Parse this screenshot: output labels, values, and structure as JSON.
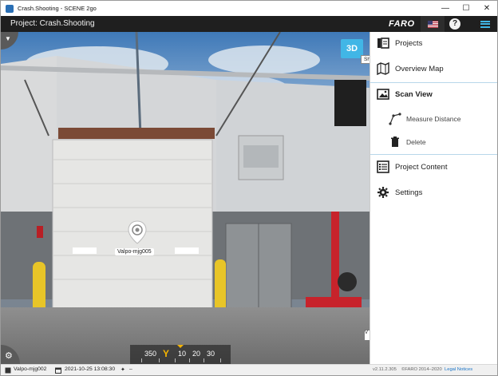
{
  "window": {
    "title": "Crash.Shooting - SCENE 2go",
    "controls": {
      "minimize": "—",
      "maximize": "☐",
      "close": "✕"
    }
  },
  "appbar": {
    "project_label": "Project: Crash.Shooting",
    "brand": "FARO",
    "help": "?"
  },
  "scene": {
    "view_mode_button": "3D",
    "tooltip": "Show Panorama Image",
    "scan_marker_label": "Valpo-mjg005",
    "compass": {
      "values": [
        "350",
        "10",
        "20",
        "30"
      ],
      "heading": "Y"
    },
    "edge_label": "V"
  },
  "menu": {
    "items": [
      {
        "label": "Projects",
        "icon": "projects-icon"
      },
      {
        "label": "Overview Map",
        "icon": "map-icon"
      },
      {
        "label": "Scan View",
        "icon": "image-icon",
        "active": true
      },
      {
        "label": "Measure Distance",
        "icon": "measure-icon",
        "sub": true
      },
      {
        "label": "Delete",
        "icon": "trash-icon",
        "sub": true
      },
      {
        "label": "Project Content",
        "icon": "list-icon"
      },
      {
        "label": "Settings",
        "icon": "gear-icon"
      }
    ]
  },
  "statusbar": {
    "scan_name": "Valpo-mjg002",
    "timestamp": "2021-10-25 13:08:30",
    "extra": "–",
    "version": "v2.11.2.305",
    "copyright": "©FARO 2014–2020",
    "legal": "Legal Notices"
  },
  "colors": {
    "accent": "#41b6e6",
    "header": "#1f1f1f",
    "active_bg": "#e8f4fb"
  }
}
